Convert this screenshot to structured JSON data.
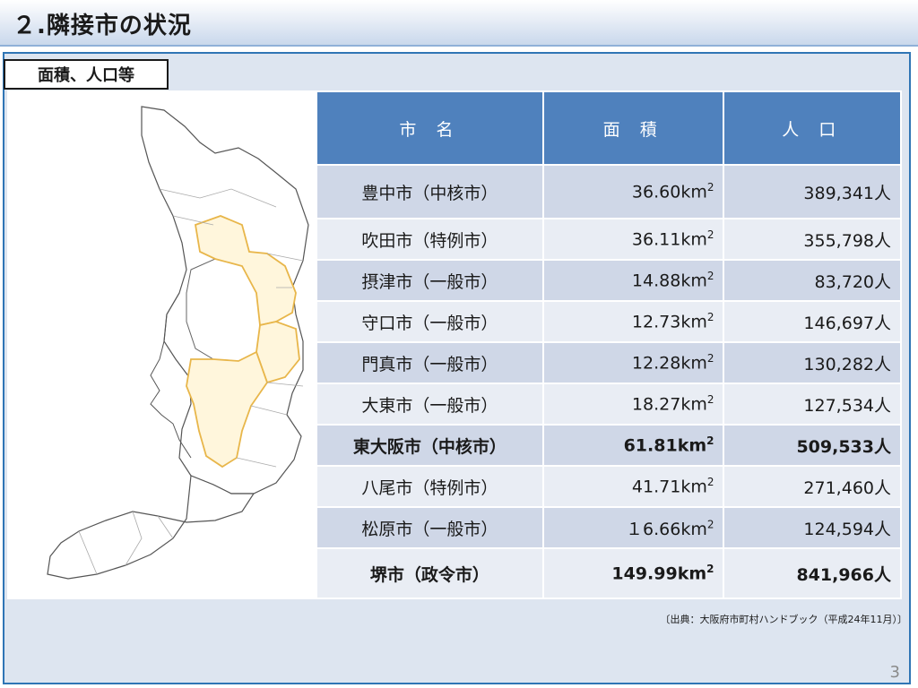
{
  "slide": {
    "title": "２.隣接市の状況",
    "section_label": "面積、人口等",
    "source_note": "〔出典：大阪府市町村ハンドブック（平成24年11月）〕",
    "page_number": "3"
  },
  "table": {
    "headers": [
      "市 名",
      "面 積",
      "人 口"
    ],
    "area_unit": "km",
    "area_unit_sup": "2",
    "rows": [
      {
        "name": "豊中市（中核市）",
        "area": "36.60",
        "population": "389,341人",
        "bold": false
      },
      {
        "name": "吹田市（特例市）",
        "area": "36.11",
        "population": "355,798人",
        "bold": false
      },
      {
        "name": "摂津市（一般市）",
        "area": "14.88",
        "population": "83,720人",
        "bold": false
      },
      {
        "name": "守口市（一般市）",
        "area": "12.73",
        "population": "146,697人",
        "bold": false
      },
      {
        "name": "門真市（一般市）",
        "area": "12.28",
        "population": "130,282人",
        "bold": false
      },
      {
        "name": "大東市（一般市）",
        "area": "18.27",
        "population": "127,534人",
        "bold": false
      },
      {
        "name": "東大阪市（中核市）",
        "area": "61.81",
        "population": "509,533人",
        "bold": true
      },
      {
        "name": "八尾市（特例市）",
        "area": "41.71",
        "population": "271,460人",
        "bold": false
      },
      {
        "name": "松原市（一般市）",
        "area": "１6.66",
        "population": "124,594人",
        "bold": false
      },
      {
        "name": "堺市（政令市）",
        "area": "149.99",
        "population": "841,966人",
        "bold": true
      }
    ]
  },
  "colors": {
    "header_blue": "#4f81bd",
    "border_blue": "#2f75b5",
    "highlight_orange": "#e8b64a"
  }
}
